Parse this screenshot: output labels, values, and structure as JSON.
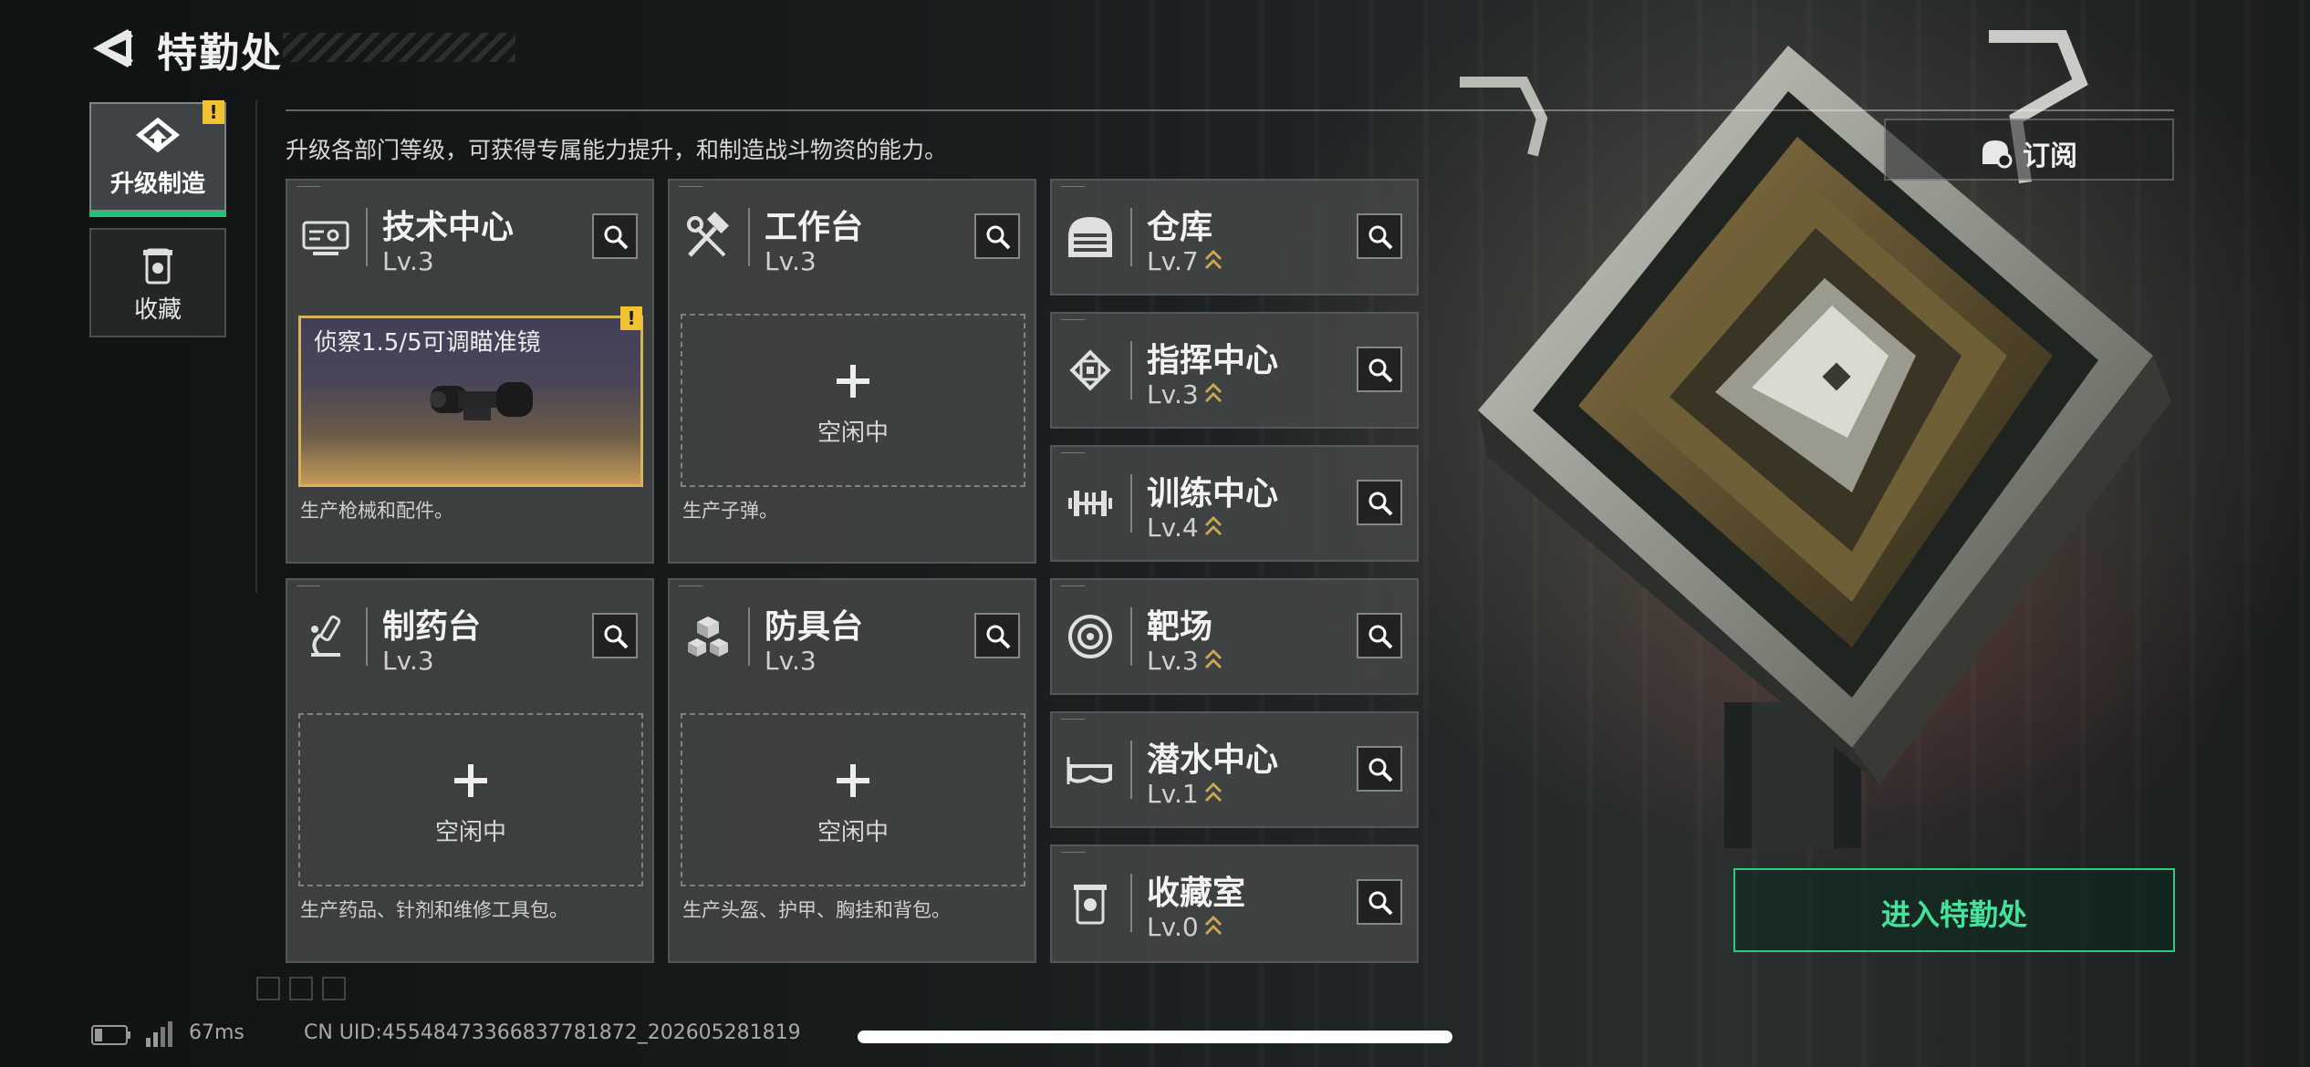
{
  "header": {
    "title": "特勤处"
  },
  "tabs": [
    {
      "label": "升级制造",
      "active": true,
      "alert": "!"
    },
    {
      "label": "收藏",
      "active": false
    }
  ],
  "subtitle": "升级各部门等级，可获得专属能力提升，和制造战斗物资的能力。",
  "subscribe_label": "订阅",
  "big_cards": [
    {
      "name": "技术中心",
      "level": "Lv.3",
      "icon": "tech-center-icon",
      "production": {
        "item": "侦察1.5/5可调瞄准镜",
        "alert": "!"
      },
      "desc": "生产枪械和配件。"
    },
    {
      "name": "工作台",
      "level": "Lv.3",
      "icon": "workbench-icon",
      "idle": "空闲中",
      "desc": "生产子弹。"
    },
    {
      "name": "制药台",
      "level": "Lv.3",
      "icon": "pharmacy-icon",
      "idle": "空闲中",
      "desc": "生产药品、针剂和维修工具包。"
    },
    {
      "name": "防具台",
      "level": "Lv.3",
      "icon": "armor-bench-icon",
      "idle": "空闲中",
      "desc": "生产头盔、护甲、胸挂和背包。"
    }
  ],
  "small_cards": [
    {
      "name": "仓库",
      "level": "Lv.7",
      "icon": "warehouse-icon"
    },
    {
      "name": "指挥中心",
      "level": "Lv.3",
      "icon": "command-center-icon"
    },
    {
      "name": "训练中心",
      "level": "Lv.4",
      "icon": "training-center-icon"
    },
    {
      "name": "靶场",
      "level": "Lv.3",
      "icon": "shooting-range-icon"
    },
    {
      "name": "潜水中心",
      "level": "Lv.1",
      "icon": "diving-center-icon"
    },
    {
      "name": "收藏室",
      "level": "Lv.0",
      "icon": "collection-room-icon"
    }
  ],
  "enter_button": "进入特勤处",
  "status": {
    "ping": "67ms",
    "uid": "CN UID:4554847336683778187​2_202605281819"
  },
  "colors": {
    "accent_green": "#2ec983",
    "alert_yellow": "#f2c230",
    "upgrade_gold": "#c9a652"
  }
}
